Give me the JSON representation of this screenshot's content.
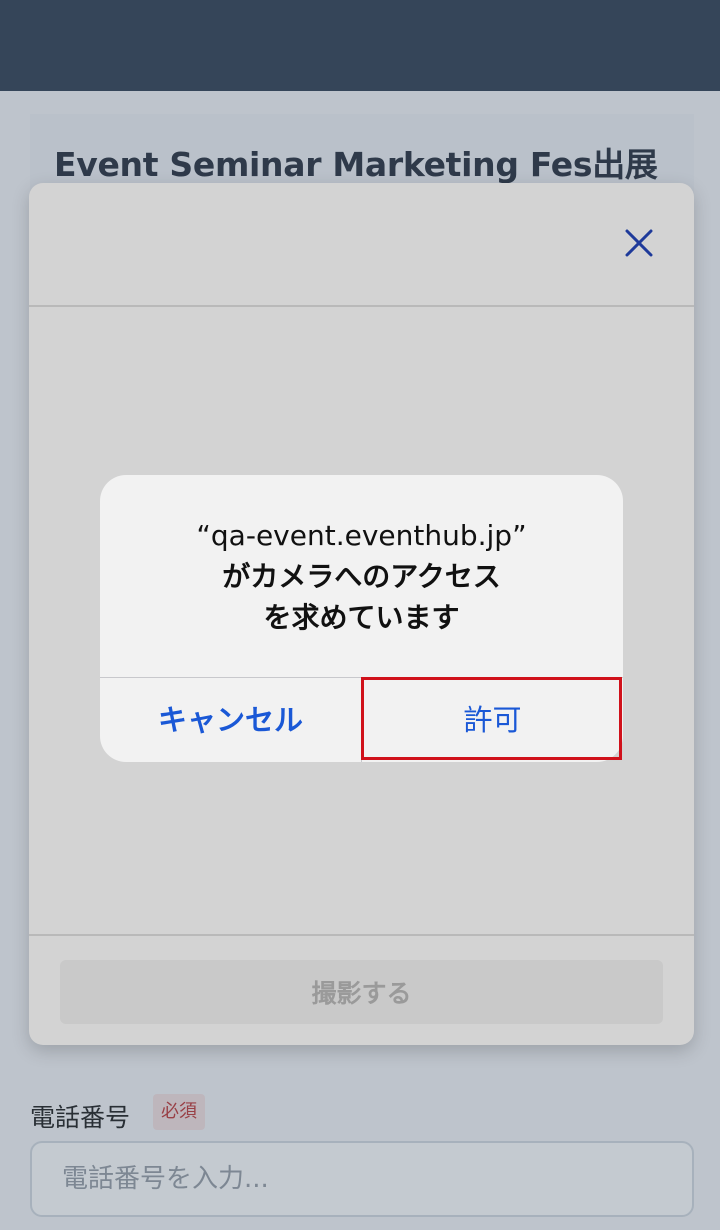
{
  "event": {
    "title": "Event Seminar Marketing Fes出展"
  },
  "form": {
    "phone_label": "電話番号",
    "required_badge": "必須",
    "phone_placeholder": "電話番号を入力..."
  },
  "camera_modal": {
    "close_icon": "close-icon",
    "capture_button_label": "撮影する"
  },
  "permission_alert": {
    "title_line1": "“qa-event.eventhub.jp”",
    "title_line2": "がカメラへのアクセス",
    "title_line3": "を求めています",
    "cancel_label": "キャンセル",
    "allow_label": "許可"
  },
  "colors": {
    "header_bg": "#334155",
    "accent_blue": "#1a58d6",
    "highlight_red": "#d0111b"
  }
}
